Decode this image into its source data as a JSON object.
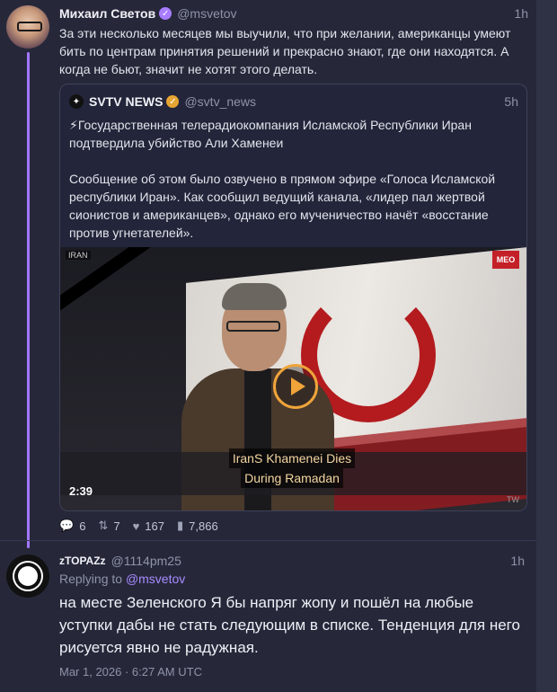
{
  "tweet": {
    "author_name": "Михаил Светов",
    "author_handle": "@msvetov",
    "time": "1h",
    "text": "За эти несколько месяцев мы выучили, что при желании, американцы умеют бить по центрам принятия решений и прекрасно знают, где они находятся. А когда не бьют, значит не хотят этого делать.",
    "quote": {
      "author_name": "SVTV NEWS",
      "author_handle": "@svtv_news",
      "time": "5h",
      "paragraph1": "⚡Государственная телерадиокомпания Исламской Республики Иран подтвердила убийство Али Хаменеи",
      "paragraph2": "Сообщение об этом было озвучено в прямом эфире «Голоса Исламской республики Иран». Как сообщил ведущий канала, «лидер пал жертвой сионистов и американцев», однако его мученичество начёт «восстание против угнетателей».",
      "video": {
        "duration": "2:39",
        "caption_line1": "IranS Khamenei Dies",
        "caption_line2": "During Ramadan",
        "tag": "IRAN",
        "channel": "MEO",
        "watermark": "TW"
      }
    },
    "stats": {
      "replies": "6",
      "retweets": "7",
      "likes": "167",
      "views": "7,866"
    }
  },
  "reply": {
    "author_name": "zTOPAZz",
    "author_handle": "@1114pm25",
    "time": "1h",
    "replying_prefix": "Replying to",
    "replying_to": "@msvetov",
    "text": "на месте Зеленского Я бы напряг жопу и пошёл на любые уступки дабы не стать следующим в списке. Тенденция для него рисуется явно не радужная.",
    "date": "Mar 1, 2026 · 6:27 AM UTC"
  },
  "icons": {
    "reply": "reply-icon",
    "retweet": "retweet-icon",
    "like": "heart-icon",
    "views": "views-icon",
    "verified": "verified-badge-icon",
    "play": "play-icon"
  },
  "colors": {
    "accent": "#a277ff",
    "background": "#26283a",
    "play_ring": "#f0a43a"
  }
}
